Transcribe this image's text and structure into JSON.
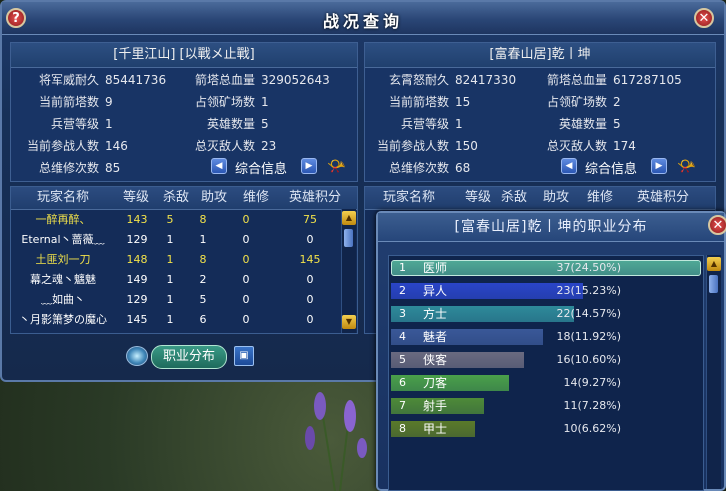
{
  "window": {
    "title": "战况查询",
    "help_label": "?",
    "close_label": "✕"
  },
  "left_guild": {
    "name": "[千里江山] [以戰メ止戰]",
    "stats": [
      {
        "label": "将军威耐久",
        "value": "85441736"
      },
      {
        "label": "箭塔总血量",
        "value": "329052643"
      },
      {
        "label": "当前箭塔数",
        "value": "9"
      },
      {
        "label": "占领矿场数",
        "value": "1"
      },
      {
        "label": "兵营等级",
        "value": "1"
      },
      {
        "label": "英雄数量",
        "value": "5"
      },
      {
        "label": "当前参战人数",
        "value": "146"
      },
      {
        "label": "总灭敌人数",
        "value": "23"
      },
      {
        "label": "总维修次数",
        "value": "85"
      }
    ],
    "nav_label": "综合信息"
  },
  "right_guild": {
    "name": "[富春山居]乾丨坤",
    "stats": [
      {
        "label": "玄霄怒耐久",
        "value": "82417330"
      },
      {
        "label": "箭塔总血量",
        "value": "617287105"
      },
      {
        "label": "当前箭塔数",
        "value": "15"
      },
      {
        "label": "占领矿场数",
        "value": "2"
      },
      {
        "label": "兵营等级",
        "value": "1"
      },
      {
        "label": "英雄数量",
        "value": "5"
      },
      {
        "label": "当前参战人数",
        "value": "150"
      },
      {
        "label": "总灭敌人数",
        "value": "174"
      },
      {
        "label": "总维修次数",
        "value": "68"
      }
    ],
    "nav_label": "综合信息"
  },
  "player_table": {
    "headers": [
      "玩家名称",
      "等级",
      "杀敌",
      "助攻",
      "维修",
      "英雄积分"
    ],
    "rows": [
      {
        "name": "一醉再醉、",
        "level": "143",
        "kills": "5",
        "assists": "8",
        "repairs": "0",
        "hero_points": "75",
        "highlight": true
      },
      {
        "name": "Eternal丶蔷薇﹏",
        "level": "129",
        "kills": "1",
        "assists": "1",
        "repairs": "0",
        "hero_points": "0",
        "highlight": false
      },
      {
        "name": "土匪刘一刀",
        "level": "148",
        "kills": "1",
        "assists": "8",
        "repairs": "0",
        "hero_points": "145",
        "highlight": true
      },
      {
        "name": "幕之魂丶魑魅",
        "level": "149",
        "kills": "1",
        "assists": "2",
        "repairs": "0",
        "hero_points": "0",
        "highlight": false
      },
      {
        "name": "﹏如曲丶",
        "level": "129",
        "kills": "1",
        "assists": "5",
        "repairs": "0",
        "hero_points": "0",
        "highlight": false
      },
      {
        "name": "丶月影箫梦の魔心",
        "level": "145",
        "kills": "1",
        "assists": "6",
        "repairs": "0",
        "hero_points": "0",
        "highlight": false
      }
    ]
  },
  "right_table": {
    "headers": [
      "玩家名称",
      "等级",
      "杀敌",
      "助攻",
      "维修",
      "英雄积分"
    ]
  },
  "buttons": {
    "occupation": "职业分布"
  },
  "popup": {
    "title": "[富春山居]乾丨坤的职业分布",
    "rows": [
      {
        "index": "1",
        "name": "医师",
        "count": "37(24.50%)",
        "fraction": 1.0,
        "color": "#4fa896"
      },
      {
        "index": "2",
        "name": "异人",
        "count": "23(15.23%)",
        "fraction": 0.62,
        "color": "#2a45c8"
      },
      {
        "index": "3",
        "name": "方士",
        "count": "22(14.57%)",
        "fraction": 0.59,
        "color": "#2e8a9a"
      },
      {
        "index": "4",
        "name": "魅者",
        "count": "18(11.92%)",
        "fraction": 0.49,
        "color": "#3a5898"
      },
      {
        "index": "5",
        "name": "侠客",
        "count": "16(10.60%)",
        "fraction": 0.43,
        "color": "#6a6a80"
      },
      {
        "index": "6",
        "name": "刀客",
        "count": "14(9.27%)",
        "fraction": 0.38,
        "color": "#4aa04a"
      },
      {
        "index": "7",
        "name": "射手",
        "count": "11(7.28%)",
        "fraction": 0.3,
        "color": "#4e8a38"
      },
      {
        "index": "8",
        "name": "甲士",
        "count": "10(6.62%)",
        "fraction": 0.27,
        "color": "#5a7a2a"
      }
    ]
  }
}
